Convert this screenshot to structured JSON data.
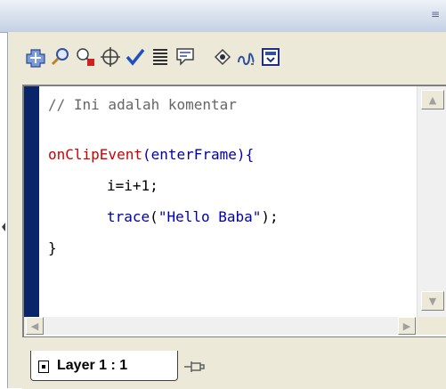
{
  "toolbar": {
    "icons": [
      "add-statement-icon",
      "find-icon",
      "insert-target-path-icon",
      "target-crosshair-icon",
      "check-syntax-icon",
      "auto-format-icon",
      "show-code-hint-icon",
      "debug-options-icon",
      "view-options-icon",
      "script-assist-icon"
    ]
  },
  "editor": {
    "lines": [
      {
        "text": "// Ini adalah komentar"
      },
      {
        "text": ""
      },
      {
        "kw": "onClipEvent",
        "rest": "(enterFrame){"
      },
      {
        "text": "i=i+1;"
      },
      {
        "fn": "trace",
        "open": "(",
        "str": "\"Hello Baba\"",
        "close": ");"
      },
      {
        "text": "}"
      }
    ]
  },
  "tabs": {
    "layer_label": "Layer 1 : 1"
  },
  "colors": {
    "keyword": "#cc0000",
    "function": "#0000b0",
    "string": "#0000b0",
    "comment": "#666666",
    "gutter": "#0a246a"
  }
}
